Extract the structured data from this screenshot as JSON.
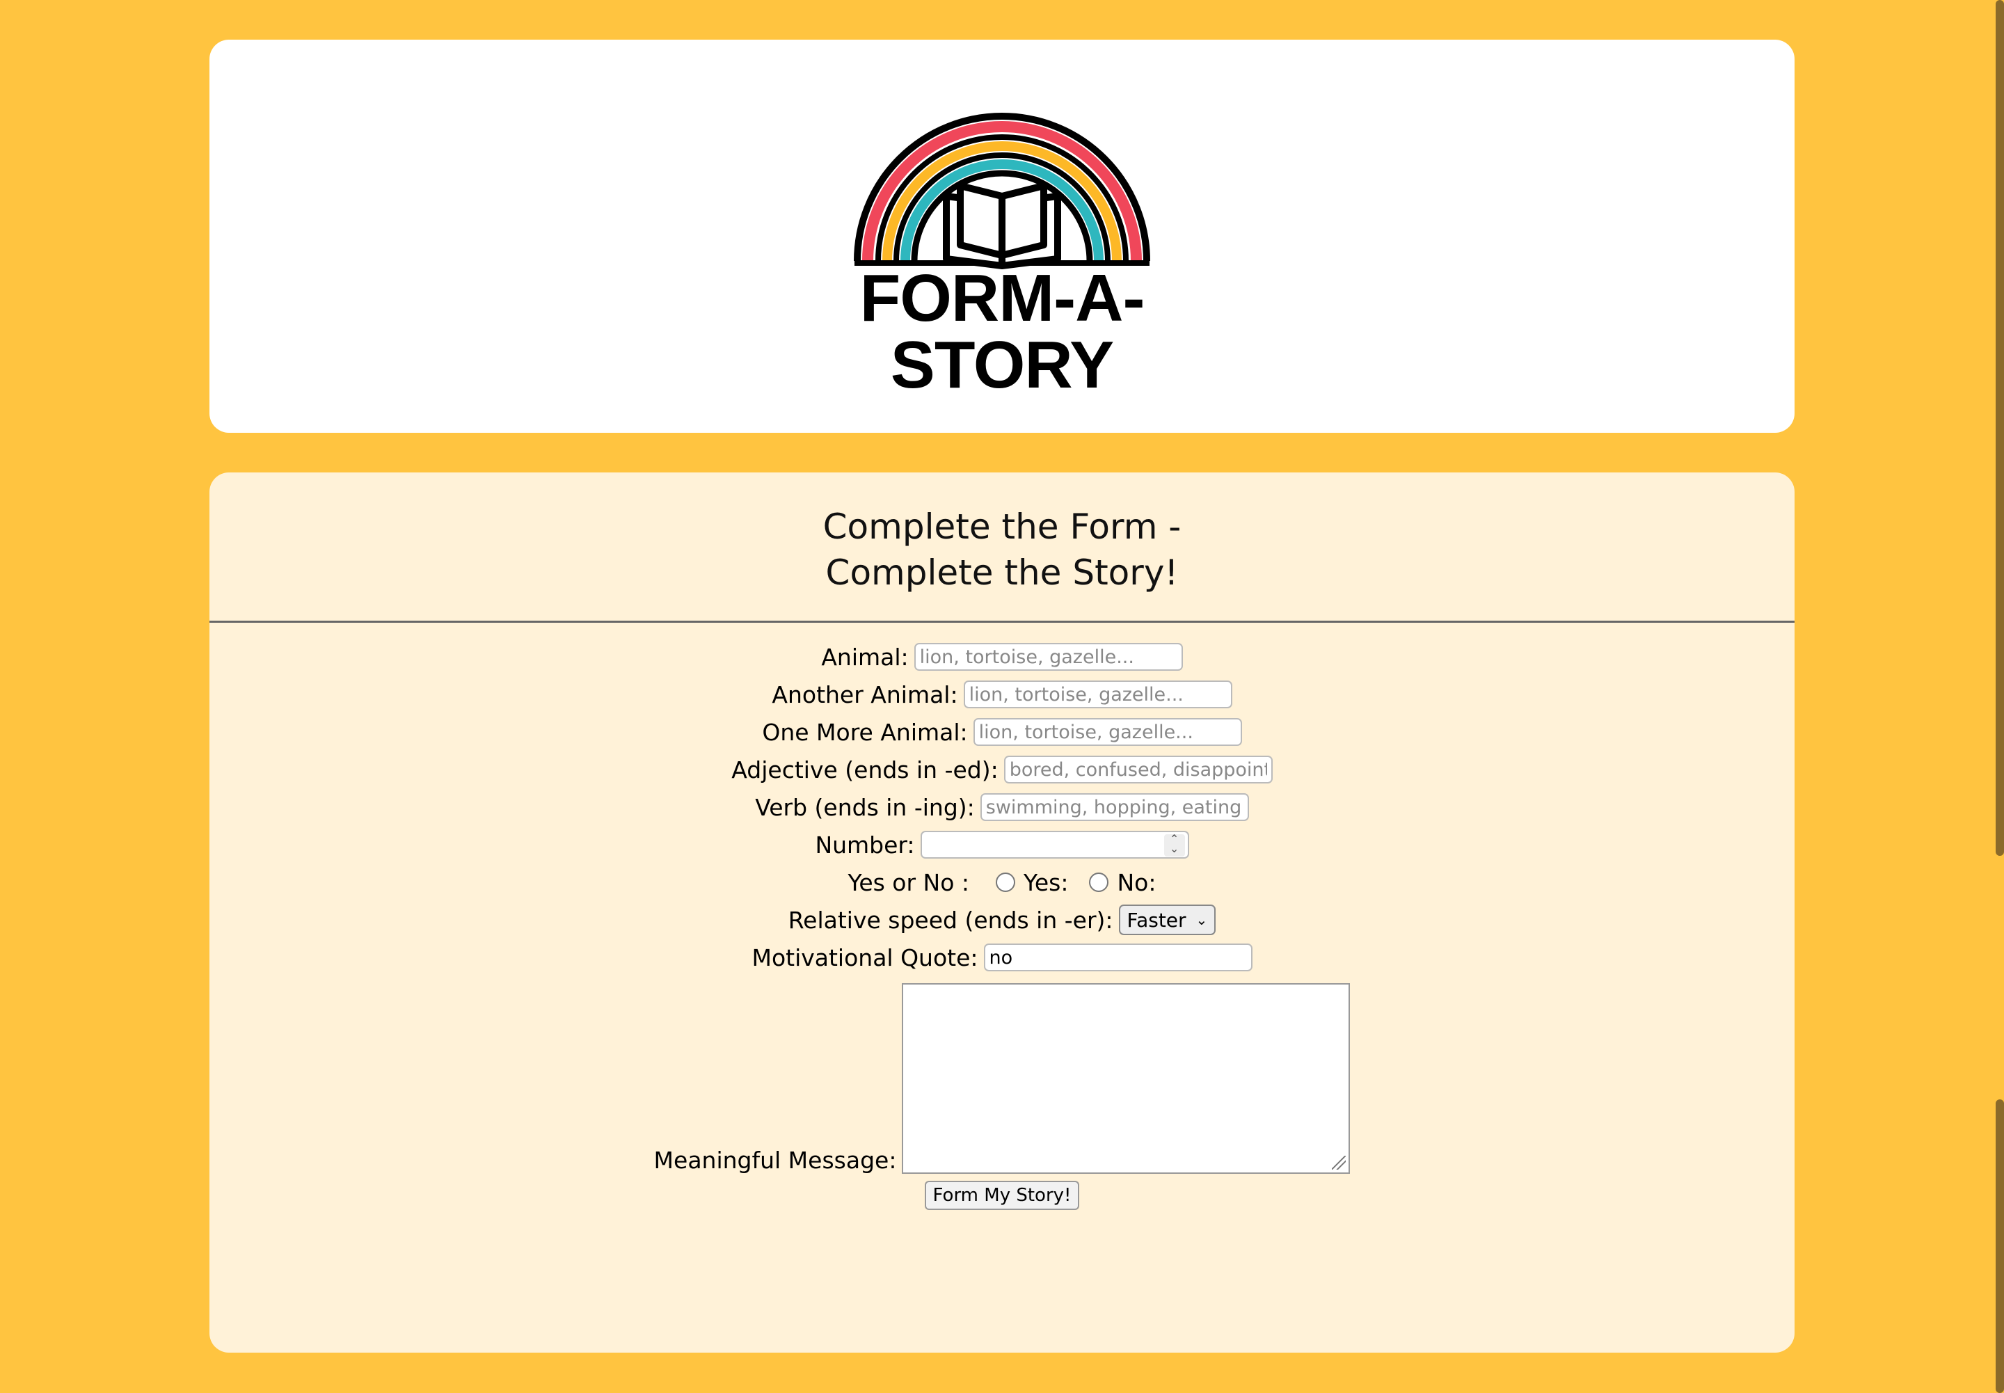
{
  "header": {
    "logo_text": "FORM-A-STORY"
  },
  "form": {
    "title_line1": "Complete the Form -",
    "title_line2": "Complete the Story!",
    "fields": {
      "animal": {
        "label": "Animal:",
        "placeholder": "lion, tortoise, gazelle..."
      },
      "another_animal": {
        "label": "Another Animal:",
        "placeholder": "lion, tortoise, gazelle..."
      },
      "one_more_animal": {
        "label": "One More Animal:",
        "placeholder": "lion, tortoise, gazelle..."
      },
      "adjective": {
        "label": "Adjective (ends in -ed):",
        "placeholder": "bored, confused, disappointed..."
      },
      "verb": {
        "label": "Verb (ends in -ing):",
        "placeholder": "swimming, hopping, eating ..."
      },
      "number": {
        "label": "Number:",
        "value": ""
      },
      "yes_no": {
        "label": "Yes or No :",
        "yes": "Yes:",
        "no": "No:"
      },
      "relative_speed": {
        "label": "Relative speed (ends in -er):",
        "selected": "Faster"
      },
      "motivational_quote": {
        "label": "Motivational Quote:",
        "value": "no"
      },
      "meaningful_message": {
        "label": "Meaningful Message:",
        "value": ""
      }
    },
    "submit_label": "Form My Story!"
  },
  "colors": {
    "background": "#FFC440",
    "form_card": "#FFF2D8",
    "rainbow_red": "#F0475A",
    "rainbow_yellow": "#FDB827",
    "rainbow_teal": "#2EB7BE"
  }
}
